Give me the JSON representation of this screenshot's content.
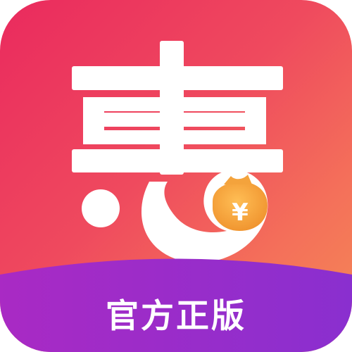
{
  "app_icon": {
    "name": "惠",
    "slogan": "官方正版",
    "money_bag_symbol": "¥",
    "colors": {
      "background_start": "#ea2a5e",
      "background_end": "#f58a55",
      "band_start": "#a92ac4",
      "band_end": "#8a2fcf",
      "glyph": "#ffffff",
      "money_bag": "#f2a23a"
    }
  }
}
